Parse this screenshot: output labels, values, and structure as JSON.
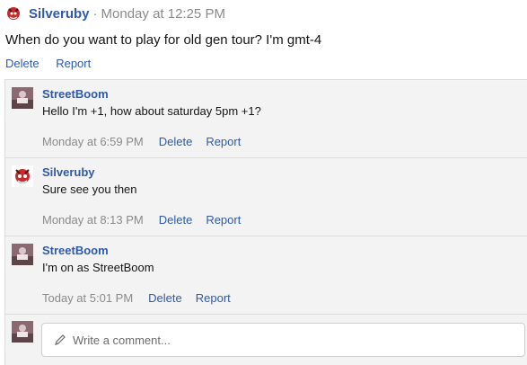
{
  "post": {
    "author": "Silveruby",
    "separator": "·",
    "timestamp": "Monday at 12:25 PM",
    "body": "When do you want to play for old gen tour? I'm gmt-4",
    "actions": {
      "delete": "Delete",
      "report": "Report"
    }
  },
  "comments": [
    {
      "author": "StreetBoom",
      "text": "Hello I'm +1, how about saturday 5pm +1?",
      "time": "Monday at 6:59 PM",
      "delete": "Delete",
      "report": "Report",
      "avatar": "streetboom-avatar"
    },
    {
      "author": "Silveruby",
      "text": "Sure see you then",
      "time": "Monday at 8:13 PM",
      "delete": "Delete",
      "report": "Report",
      "avatar": "silveruby-avatar"
    },
    {
      "author": "StreetBoom",
      "text": "I'm on as StreetBoom",
      "time": "Today at 5:01 PM",
      "delete": "Delete",
      "report": "Report",
      "avatar": "streetboom-avatar"
    }
  ],
  "composer": {
    "placeholder": "Write a comment...",
    "icon": "pencil-icon"
  },
  "colors": {
    "link": "#2f5aa8",
    "muted": "#8a8a8a",
    "panel": "#f3f3f3",
    "border": "#dcdcdc"
  }
}
